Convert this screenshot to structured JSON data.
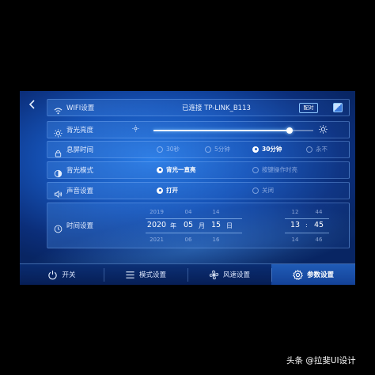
{
  "settings": {
    "wifi": {
      "label": "WIFI设置",
      "status": "已连接  TP-LINK_B113",
      "pair_label": "配对"
    },
    "brightness": {
      "label": "背光亮度",
      "level": 0.85
    },
    "screen_off": {
      "label": "息屏时间",
      "options": [
        {
          "label": "30秒",
          "checked": false
        },
        {
          "label": "5分钟",
          "checked": false
        },
        {
          "label": "30分钟",
          "checked": true
        },
        {
          "label": "永不",
          "checked": false
        }
      ]
    },
    "backlight": {
      "label": "背光模式",
      "options": [
        {
          "label": "背光一直亮",
          "checked": true
        },
        {
          "label": "按键操作时亮",
          "checked": false
        }
      ]
    },
    "sound": {
      "label": "声音设置",
      "options": [
        {
          "label": "打开",
          "checked": true
        },
        {
          "label": "关闭",
          "checked": false
        }
      ]
    },
    "time": {
      "label": "时间设置",
      "year": {
        "prev": "2019",
        "current": "2020",
        "next": "2021",
        "unit": "年"
      },
      "month": {
        "prev": "04",
        "current": "05",
        "next": "06",
        "unit": "月"
      },
      "day": {
        "prev": "14",
        "current": "15",
        "next": "16",
        "unit": "日"
      },
      "hour": {
        "prev": "12",
        "current": "13",
        "next": "14"
      },
      "minute": {
        "prev": "44",
        "current": "45",
        "next": "46"
      },
      "separator": ":"
    }
  },
  "bottom_nav": {
    "items": [
      {
        "label": "开关",
        "icon": "power-icon",
        "active": false
      },
      {
        "label": "模式设置",
        "icon": "menu-icon",
        "active": false
      },
      {
        "label": "风速设置",
        "icon": "fan-icon",
        "active": false
      },
      {
        "label": "参数设置",
        "icon": "gear-icon",
        "active": true
      }
    ]
  },
  "watermark": "头条 @拉斐UI设计",
  "colors": {
    "accent": "#2a7ee8",
    "background": "#0b2e7a",
    "active_tab": "#2e7de6"
  }
}
